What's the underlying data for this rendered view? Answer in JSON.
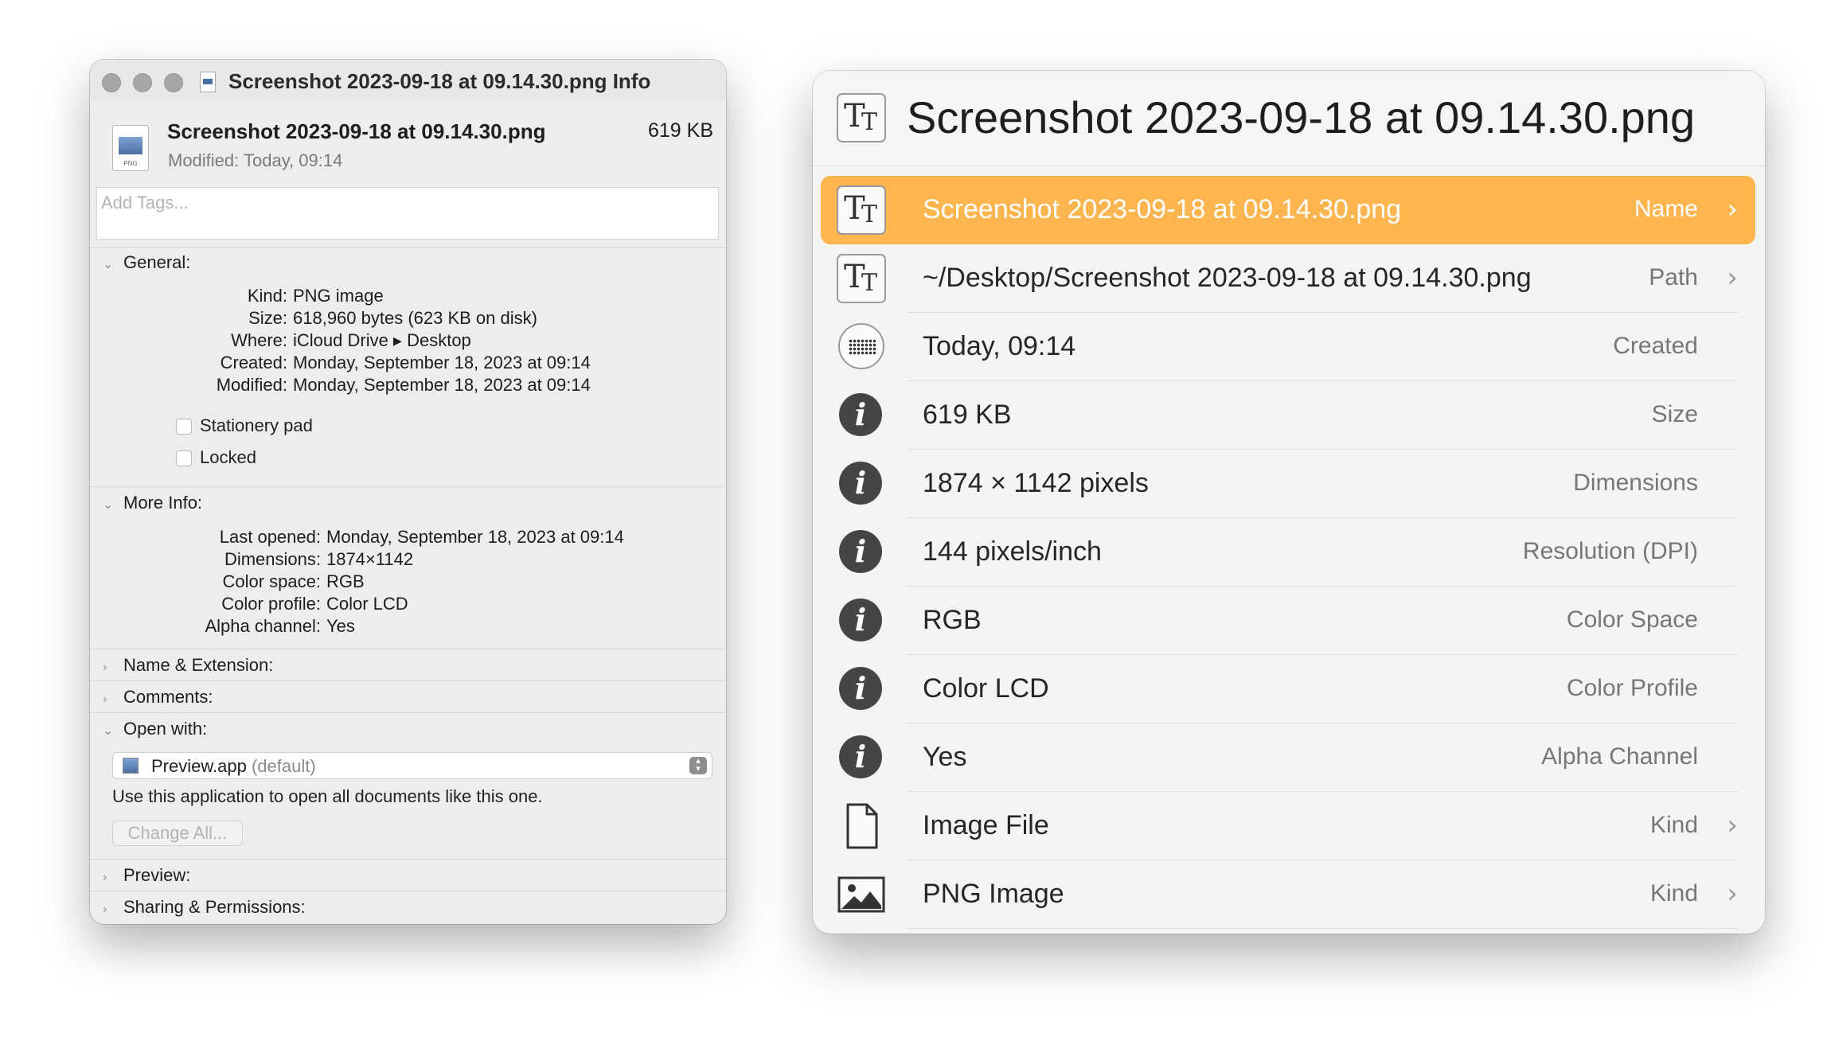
{
  "info_window": {
    "title": "Screenshot 2023-09-18 at 09.14.30.png Info",
    "file_name": "Screenshot 2023-09-18 at 09.14.30.png",
    "file_size": "619 KB",
    "modified_line": "Modified: Today, 09:14",
    "doc_icon_label": "PNG",
    "tags_placeholder": "Add Tags...",
    "general": {
      "header": "General:",
      "rows": [
        {
          "key": "Kind:",
          "value": "PNG image"
        },
        {
          "key": "Size:",
          "value": "618,960 bytes (623 KB on disk)"
        },
        {
          "key": "Where:",
          "value": "iCloud Drive ▸ Desktop"
        },
        {
          "key": "Created:",
          "value": "Monday, September 18, 2023 at 09:14"
        },
        {
          "key": "Modified:",
          "value": "Monday, September 18, 2023 at 09:14"
        }
      ],
      "stationery_label": "Stationery pad",
      "locked_label": "Locked"
    },
    "more_info": {
      "header": "More Info:",
      "rows": [
        {
          "key": "Last opened:",
          "value": "Monday, September 18, 2023 at 09:14"
        },
        {
          "key": "Dimensions:",
          "value": "1874×1142"
        },
        {
          "key": "Color space:",
          "value": "RGB"
        },
        {
          "key": "Color profile:",
          "value": "Color LCD"
        },
        {
          "key": "Alpha channel:",
          "value": "Yes"
        }
      ]
    },
    "name_extension": "Name & Extension:",
    "comments": "Comments:",
    "open_with": {
      "header": "Open with:",
      "app": "Preview.app",
      "default_suffix": "(default)",
      "use_text": "Use this application to open all documents like this one.",
      "change_all": "Change All..."
    },
    "preview": "Preview:",
    "sharing": "Sharing & Permissions:"
  },
  "panel": {
    "title": "Screenshot 2023-09-18 at 09.14.30.png",
    "title_icon": "text-format-icon",
    "accent_color": "#fdb64f",
    "rows": [
      {
        "icon": "text-format-icon",
        "value": "Screenshot 2023-09-18 at 09.14.30.png",
        "label": "Name",
        "arrow": "›",
        "selected": true
      },
      {
        "icon": "text-format-icon",
        "value": "~/Desktop/Screenshot 2023-09-18 at 09.14.30.png",
        "label": "Path",
        "arrow": "›"
      },
      {
        "icon": "calendar-icon",
        "value": "Today, 09:14",
        "label": "Created"
      },
      {
        "icon": "info-icon",
        "value": "619 KB",
        "label": "Size"
      },
      {
        "icon": "info-icon",
        "value": "1874 × 1142 pixels",
        "label": "Dimensions"
      },
      {
        "icon": "info-icon",
        "value": "144 pixels/inch",
        "label": "Resolution (DPI)"
      },
      {
        "icon": "info-icon",
        "value": "RGB",
        "label": "Color Space"
      },
      {
        "icon": "info-icon",
        "value": "Color LCD",
        "label": "Color Profile"
      },
      {
        "icon": "info-icon",
        "value": "Yes",
        "label": "Alpha Channel"
      },
      {
        "icon": "document-icon",
        "value": "Image File",
        "label": "Kind",
        "arrow": "›"
      },
      {
        "icon": "image-icon",
        "value": "PNG Image",
        "label": "Kind",
        "arrow": "›"
      }
    ]
  },
  "glyphs": {
    "chevron_right": "›",
    "chevron_down": "⌄",
    "tt": "T"
  }
}
